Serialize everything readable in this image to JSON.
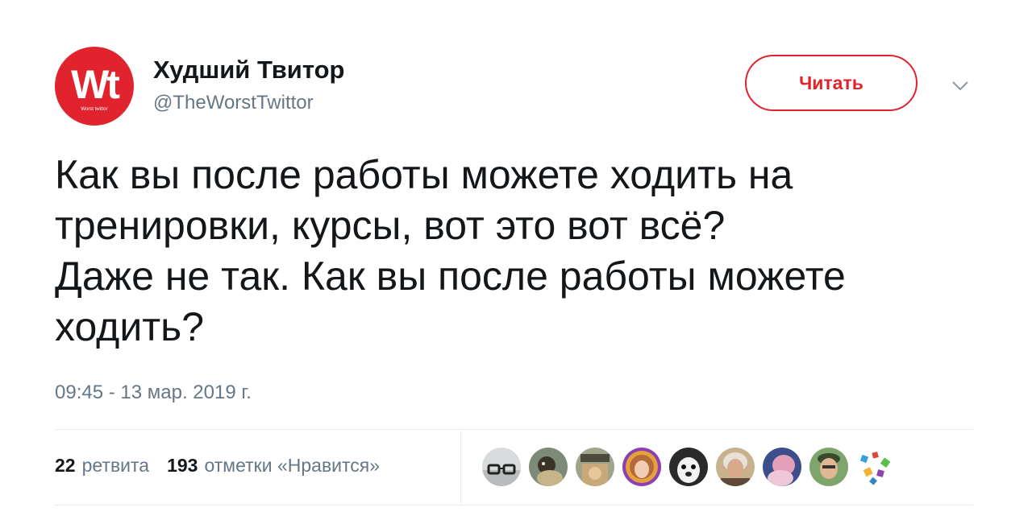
{
  "header": {
    "avatar_logo": "Wt",
    "avatar_logo_sub": "Worst twittor",
    "display_name": "Худший Твитор",
    "handle": "@TheWorstTwittor",
    "follow_label": "Читать"
  },
  "tweet": {
    "text": "Как вы после работы можете ходить на\nтренировки, курсы, вот это вот всё?\nДаже не так. Как вы после работы можете\nходить?",
    "timestamp": "09:45 - 13 мар. 2019 г."
  },
  "stats": {
    "retweets_count": "22",
    "retweets_label": "ретвита",
    "likes_count": "193",
    "likes_label": "отметки «Нравится»"
  },
  "likers": [
    {
      "icon": "avatar-glasses-icon"
    },
    {
      "icon": "avatar-animal-icon"
    },
    {
      "icon": "avatar-sign-icon"
    },
    {
      "icon": "avatar-woman-icon"
    },
    {
      "icon": "avatar-dog-icon"
    },
    {
      "icon": "avatar-elder-icon"
    },
    {
      "icon": "avatar-portrait-icon"
    },
    {
      "icon": "avatar-man-icon"
    },
    {
      "icon": "avatar-gems-icon"
    }
  ],
  "colors": {
    "brand_red": "#e0232c",
    "text_primary": "#14171a",
    "text_secondary": "#657786",
    "divider": "#e6ecf0"
  }
}
